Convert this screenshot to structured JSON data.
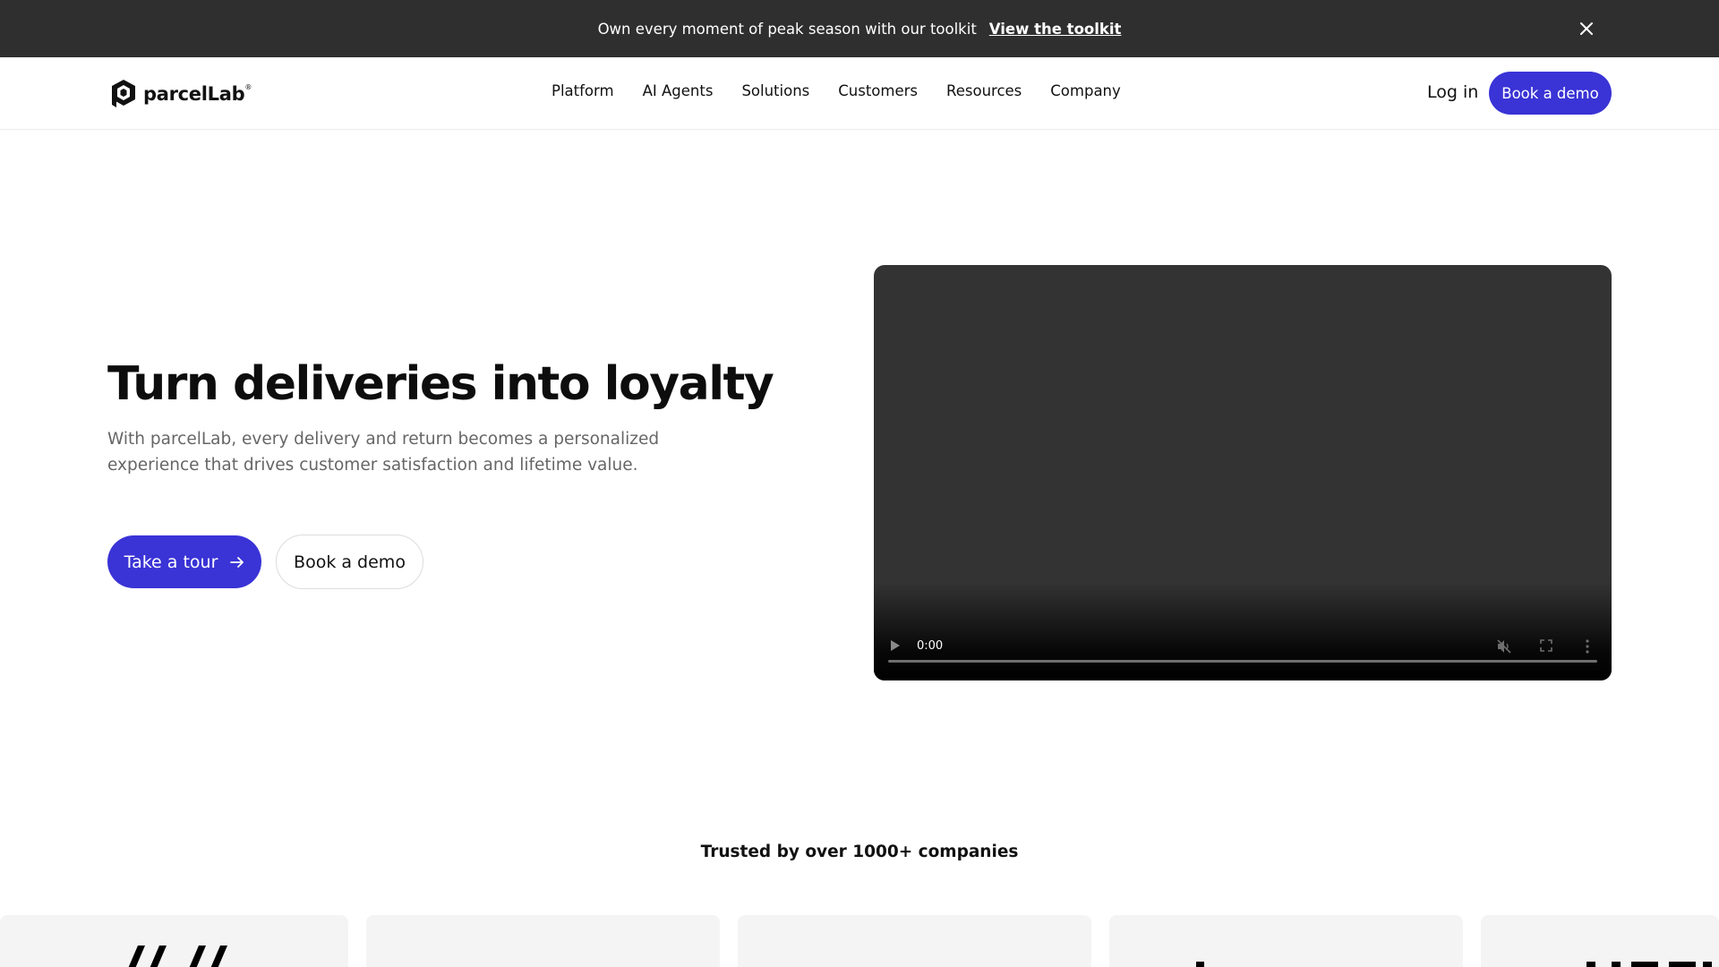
{
  "announcement": {
    "message": "Own every moment of peak season with our toolkit",
    "link": "View the toolkit",
    "close_icon": "close-icon"
  },
  "header": {
    "logo_text": "parcelLab",
    "logo_mark": "®",
    "nav": [
      "Platform",
      "AI Agents",
      "Solutions",
      "Customers",
      "Resources",
      "Company"
    ],
    "login": "Log in",
    "demo_button": "Book a demo"
  },
  "hero": {
    "title": "Turn deliveries into loyalty",
    "subtitle": "With parcelLab, every delivery and return becomes a personalized experience that drives customer satisfaction and lifetime value.",
    "tour_button": "Take a tour",
    "tour_icon": "arrow-right-icon",
    "demo_button": "Book a demo"
  },
  "video": {
    "time": "0:00",
    "progress": 0
  },
  "trusted": {
    "heading": "Trusted by over 1000+ companies"
  },
  "colors": {
    "accent": "#3a33d6",
    "announce_bg": "#2f2f2f",
    "video_bg": "#333333",
    "card_bg": "#f4f4f4"
  }
}
